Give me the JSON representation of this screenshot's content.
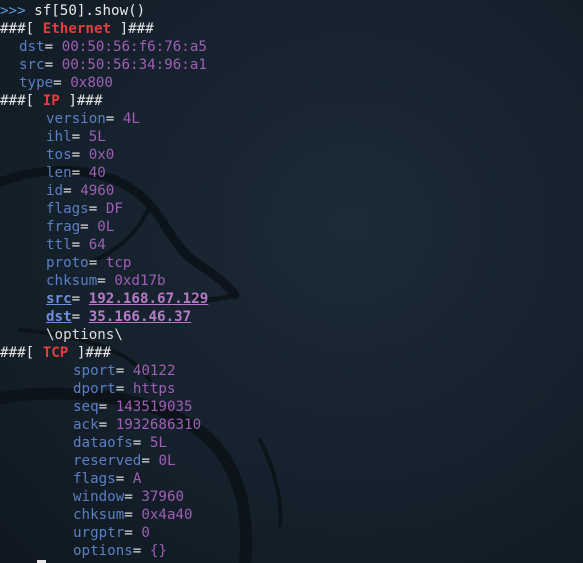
{
  "prompt": ">>>",
  "command": "sf[50].show()",
  "layers": {
    "ethernet": {
      "open": "###[ ",
      "name": "Ethernet",
      "close": " ]###",
      "fields": [
        {
          "name": "dst",
          "value": "00:50:56:f6:76:a5"
        },
        {
          "name": "src",
          "value": "00:50:56:34:96:a1"
        },
        {
          "name": "type",
          "value": "0x800"
        }
      ]
    },
    "ip": {
      "open": "###[ ",
      "name": "IP",
      "close": " ]###",
      "fields": [
        {
          "name": "version",
          "value": "4L"
        },
        {
          "name": "ihl",
          "value": "5L"
        },
        {
          "name": "tos",
          "value": "0x0"
        },
        {
          "name": "len",
          "value": "40"
        },
        {
          "name": "id",
          "value": "4960"
        },
        {
          "name": "flags",
          "value": "DF"
        },
        {
          "name": "frag",
          "value": "0L"
        },
        {
          "name": "ttl",
          "value": "64"
        },
        {
          "name": "proto",
          "value": "tcp"
        },
        {
          "name": "chksum",
          "value": "0xd17b"
        },
        {
          "name": "src",
          "value": "192.168.67.129",
          "emphasis": true
        },
        {
          "name": "dst",
          "value": "35.166.46.37",
          "emphasis": true
        }
      ],
      "options_marker": "\\options\\"
    },
    "tcp": {
      "open": "###[ ",
      "name": "TCP",
      "close": " ]###",
      "fields": [
        {
          "name": "sport",
          "value": "40122"
        },
        {
          "name": "dport",
          "value": "https"
        },
        {
          "name": "seq",
          "value": "143519035"
        },
        {
          "name": "ack",
          "value": "1932686310"
        },
        {
          "name": "dataofs",
          "value": "5L"
        },
        {
          "name": "reserved",
          "value": "0L"
        },
        {
          "name": "flags",
          "value": "A"
        },
        {
          "name": "window",
          "value": "37960"
        },
        {
          "name": "chksum",
          "value": "0x4a40"
        },
        {
          "name": "urgptr",
          "value": "0"
        },
        {
          "name": "options",
          "value": "{}"
        }
      ]
    }
  },
  "field_separator": "= ",
  "colors": {
    "background": "#15212c",
    "prompt": "#5b9bd5",
    "layer_name": "#e83c3c",
    "field_name": "#5c7fc4",
    "field_value": "#a05fb4"
  },
  "background_icon": "kali-dragon-icon"
}
